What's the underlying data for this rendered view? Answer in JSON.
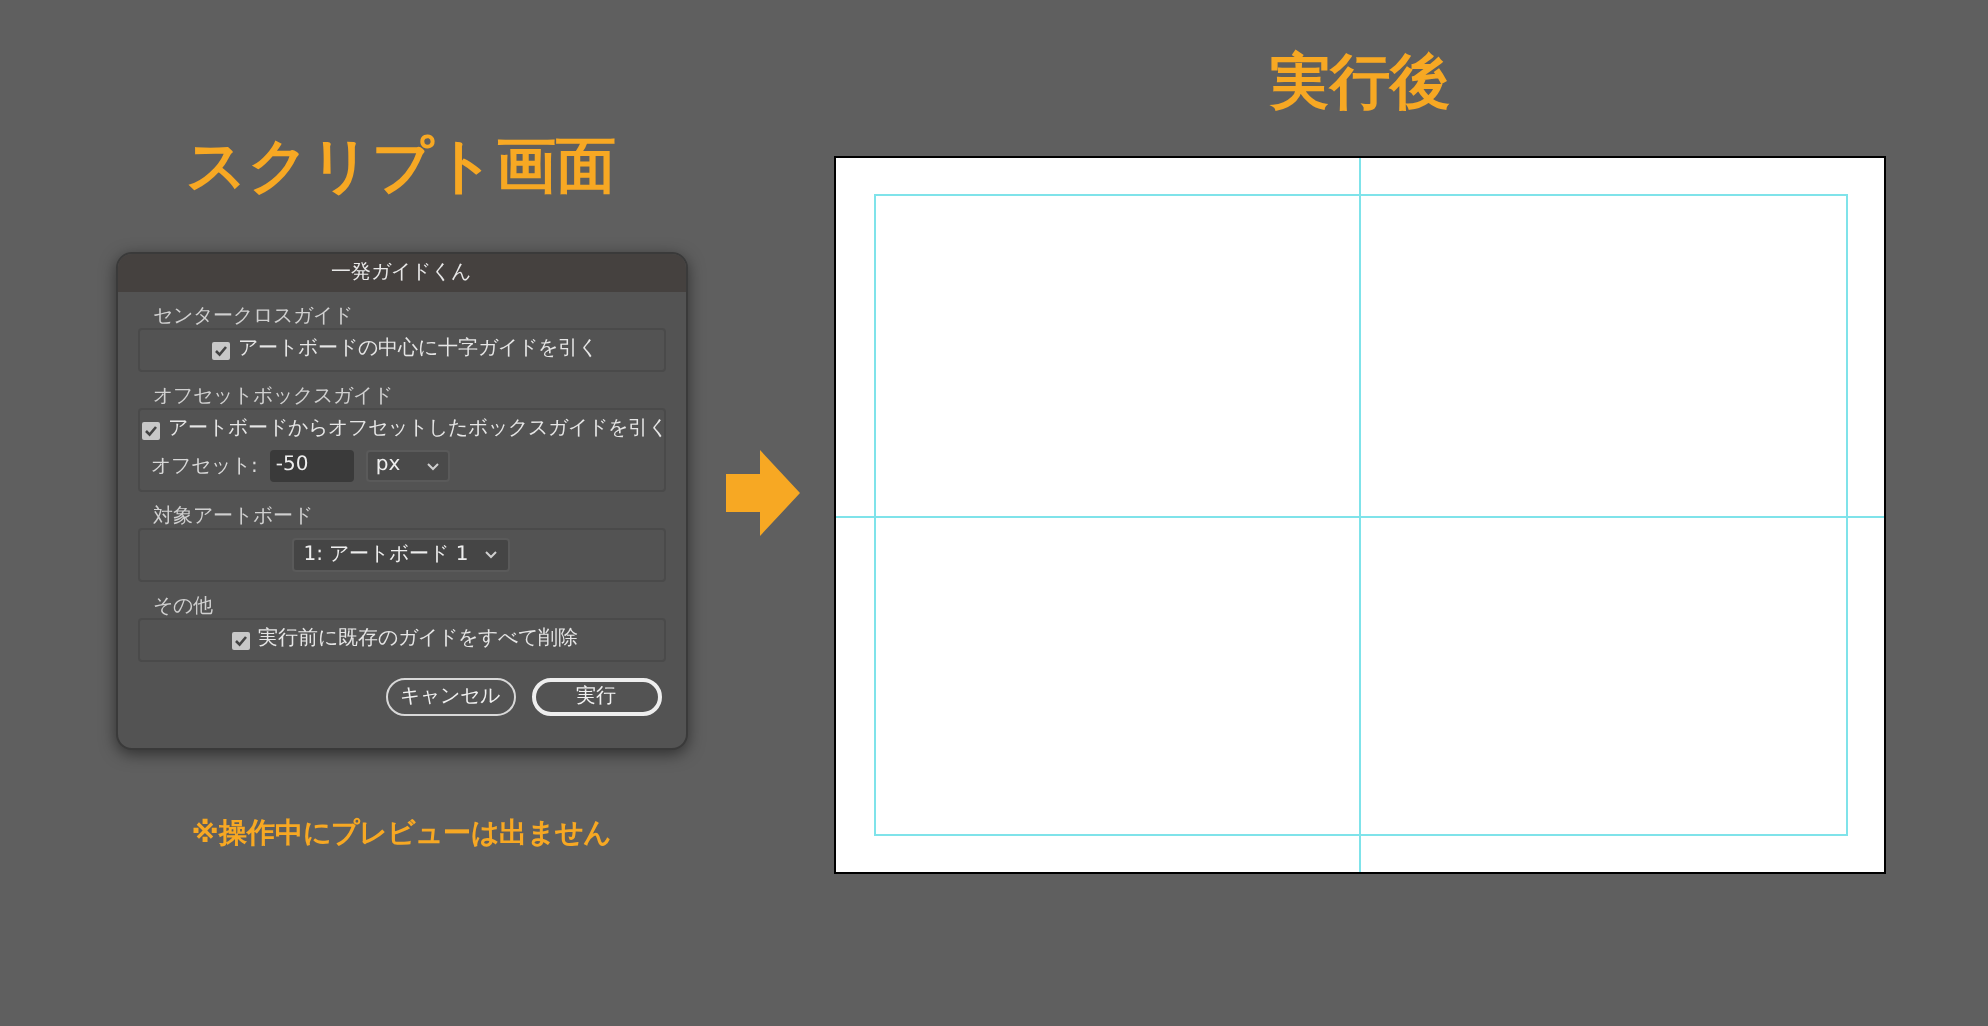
{
  "left_heading": "スクリプト画面",
  "dialog": {
    "title": "一発ガイドくん",
    "sections": [
      {
        "legend": "センタークロスガイド",
        "rows": [
          {
            "kind": "checkbox",
            "label": "アートボードの中心に十字ガイドを引く",
            "checked": true
          }
        ]
      },
      {
        "legend": "オフセットボックスガイド",
        "rows": [
          {
            "kind": "checkbox",
            "label": "アートボードからオフセットしたボックスガイドを引く",
            "checked": true
          },
          {
            "kind": "offset",
            "label": "オフセット:",
            "value": "-50",
            "unit": "px"
          }
        ]
      },
      {
        "legend": "対象アートボード",
        "rows": [
          {
            "kind": "dropdown",
            "value": "1: アートボード 1"
          }
        ]
      },
      {
        "legend": "その他",
        "rows": [
          {
            "kind": "checkbox",
            "label": "実行前に既存のガイドをすべて削除",
            "checked": true
          }
        ]
      }
    ],
    "buttons": [
      {
        "label": "キャンセル",
        "default": false
      },
      {
        "label": "実行",
        "default": true
      }
    ]
  },
  "note": "※操作中にプレビューは出ません",
  "right_heading": "実行後"
}
